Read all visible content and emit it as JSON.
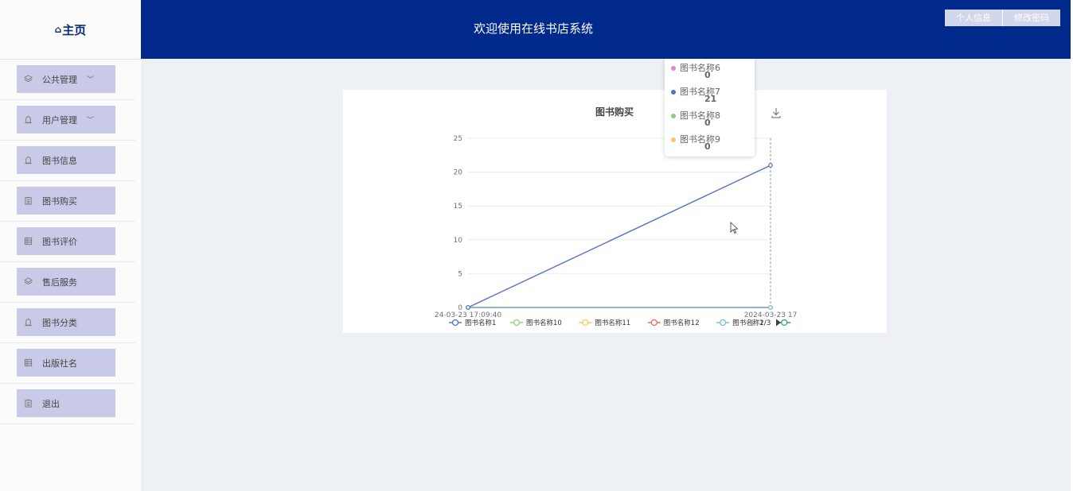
{
  "sidebar": {
    "home": "主页",
    "items": [
      {
        "label": "公共管理",
        "icon": "layers-icon",
        "expand": true
      },
      {
        "label": "用户管理",
        "icon": "bell-icon",
        "expand": true
      },
      {
        "label": "图书信息",
        "icon": "bell-icon",
        "expand": false
      },
      {
        "label": "图书购买",
        "icon": "clipboard-icon",
        "expand": false
      },
      {
        "label": "图书评价",
        "icon": "list-icon",
        "expand": false
      },
      {
        "label": "售后服务",
        "icon": "layers-icon",
        "expand": false
      },
      {
        "label": "图书分类",
        "icon": "bell-icon",
        "expand": false
      },
      {
        "label": "出版社名",
        "icon": "list-icon",
        "expand": false
      },
      {
        "label": "退出",
        "icon": "clipboard-icon",
        "expand": false
      }
    ]
  },
  "header": {
    "title": "欢迎使用在线书店系统",
    "btn_profile": "个人信息",
    "btn_password": "修改密码"
  },
  "chart_data": {
    "type": "line",
    "title": "图书购买",
    "x": [
      "2024-03-23 17:09:40",
      "2024-03-23 17"
    ],
    "x_labels_shown": [
      "24-03-23 17:09:40",
      "2024-03-23 17"
    ],
    "ylim": [
      0,
      25
    ],
    "yticks": [
      0,
      5,
      10,
      15,
      20,
      25
    ],
    "grid": true,
    "series": [
      {
        "name": "图书名称1",
        "color": "#5470c6",
        "values": [
          0,
          21
        ]
      },
      {
        "name": "图书名称10",
        "color": "#91cc75",
        "values": [
          0,
          0
        ]
      },
      {
        "name": "图书名称11",
        "color": "#fac858",
        "values": [
          0,
          0
        ]
      },
      {
        "name": "图书名称12",
        "color": "#ee6666",
        "values": [
          0,
          0
        ]
      },
      {
        "name": "图书名称2",
        "color": "#73c0de",
        "values": [
          0,
          0
        ]
      }
    ],
    "legend": {
      "position": "bottom",
      "items": [
        {
          "name": "图书名称1",
          "color": "#5470c6"
        },
        {
          "name": "图书名称10",
          "color": "#91cc75"
        },
        {
          "name": "图书名称11",
          "color": "#fac858"
        },
        {
          "name": "图书名称12",
          "color": "#ee6666"
        },
        {
          "name": "图书名称2",
          "color": "#73c0de"
        },
        {
          "name": "",
          "color": "#3ba272"
        }
      ],
      "page": "1/3"
    },
    "tooltip": [
      {
        "name": "图书名称6",
        "value": "0",
        "color": "#e682c8"
      },
      {
        "name": "图书名称7",
        "value": "21",
        "color": "#5470c6"
      },
      {
        "name": "图书名称8",
        "value": "0",
        "color": "#91cc75"
      },
      {
        "name": "图书名称9",
        "value": "0",
        "color": "#fac858"
      }
    ]
  }
}
